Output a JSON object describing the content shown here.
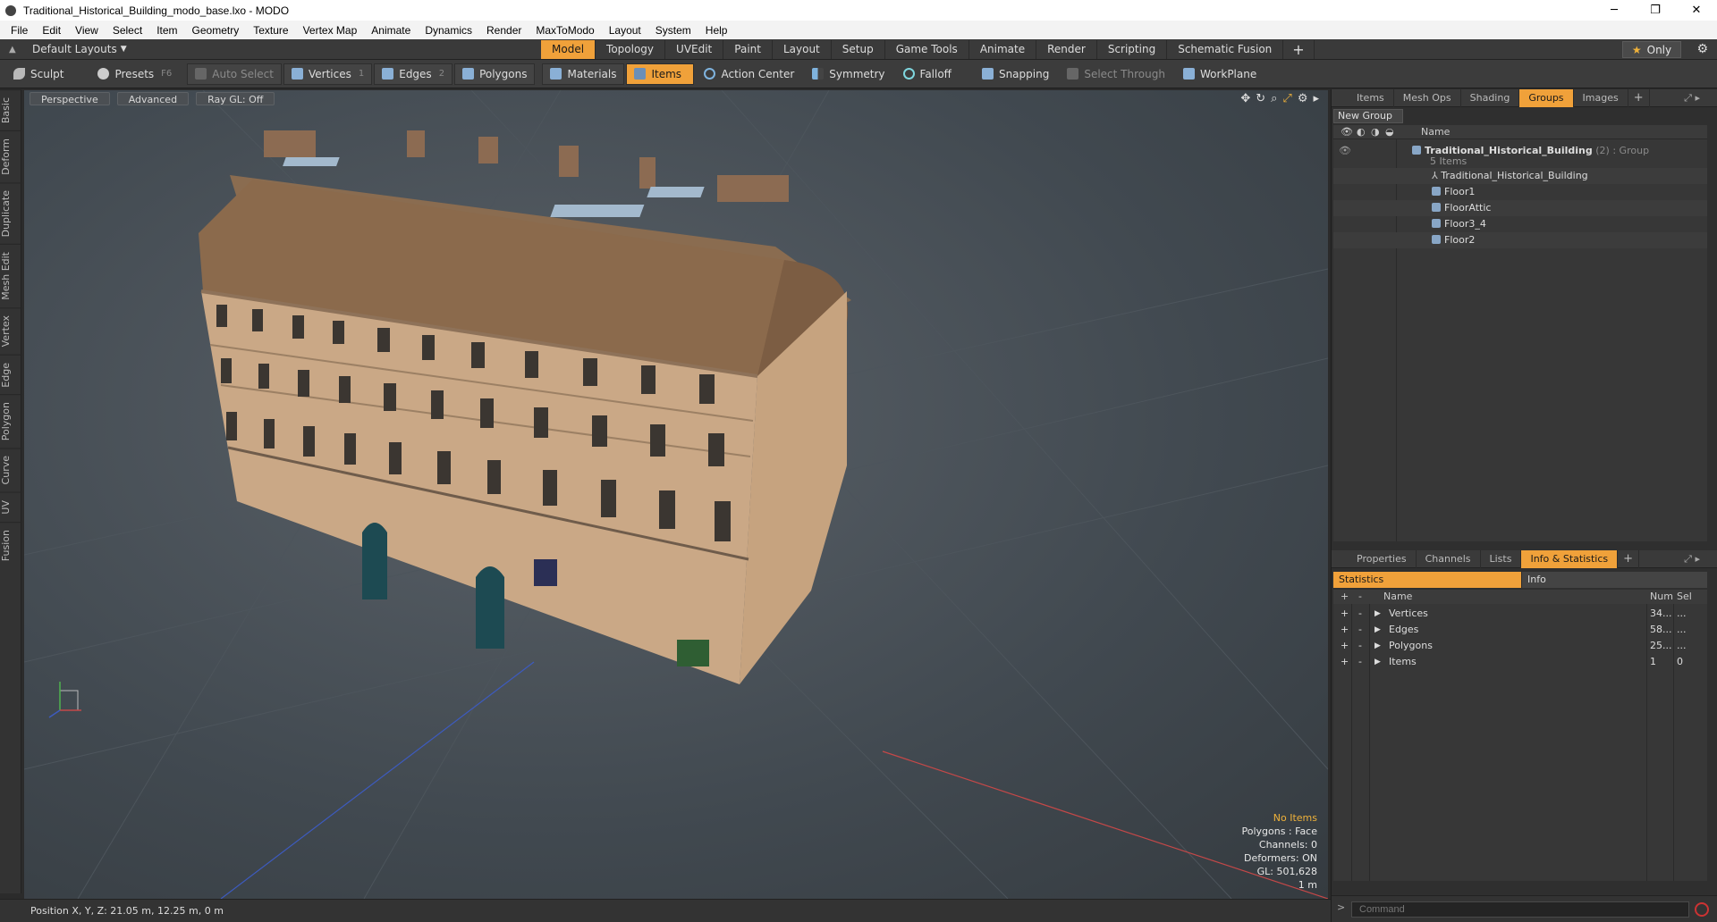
{
  "window": {
    "title": "Traditional_Historical_Building_modo_base.lxo - MODO",
    "minimize": "─",
    "maximize": "❐",
    "close": "✕"
  },
  "menu": [
    "File",
    "Edit",
    "View",
    "Select",
    "Item",
    "Geometry",
    "Texture",
    "Vertex Map",
    "Animate",
    "Dynamics",
    "Render",
    "MaxToModo",
    "Layout",
    "System",
    "Help"
  ],
  "layout": {
    "dropdown": "Default Layouts",
    "tabs": [
      "Model",
      "Topology",
      "UVEdit",
      "Paint",
      "Layout",
      "Setup",
      "Game Tools",
      "Animate",
      "Render",
      "Scripting",
      "Schematic Fusion"
    ],
    "active_tab": "Model",
    "plus": "+",
    "only": "Only"
  },
  "toolbar": {
    "sculpt": "Sculpt",
    "presets": "Presets",
    "presets_key": "F6",
    "auto_select": "Auto Select",
    "vertices": "Vertices",
    "vertices_key": "1",
    "edges": "Edges",
    "edges_key": "2",
    "polygons": "Polygons",
    "materials": "Materials",
    "items": "Items",
    "action_center": "Action Center",
    "symmetry": "Symmetry",
    "falloff": "Falloff",
    "snapping": "Snapping",
    "select_through": "Select Through",
    "workplane": "WorkPlane"
  },
  "left_tabs": [
    "Basic",
    "Deform",
    "Duplicate",
    "Mesh Edit",
    "Vertex",
    "Edge",
    "Polygon",
    "Curve",
    "UV",
    "Fusion"
  ],
  "viewport": {
    "view": "Perspective",
    "shading": "Advanced",
    "raygl": "Ray GL: Off",
    "info": {
      "selection": "No Items",
      "polygons": "Polygons : Face",
      "channels": "Channels: 0",
      "deformers": "Deformers: ON",
      "gl": "GL: 501,628",
      "scale": "1 m"
    }
  },
  "status": {
    "position": "Position X, Y, Z:  21.05 m, 12.25 m, 0 m"
  },
  "top_panel": {
    "tabs": [
      "Items",
      "Mesh Ops",
      "Shading",
      "Groups",
      "Images"
    ],
    "active_tab": "Groups",
    "new_group": "New Group",
    "name_header": "Name",
    "group": {
      "name": "Traditional_Historical_Building",
      "count": "(2)",
      "type": ": Group",
      "items_label": "5 Items",
      "children": [
        "Traditional_Historical_Building",
        "Floor1",
        "FloorAttic",
        "Floor3_4",
        "Floor2"
      ]
    }
  },
  "bottom_panel": {
    "tabs": [
      "Properties",
      "Channels",
      "Lists",
      "Info & Statistics"
    ],
    "active_tab": "Info & Statistics",
    "subtabs": [
      "Statistics",
      "Info"
    ],
    "headers": {
      "name": "Name",
      "num": "Num",
      "sel": "Sel"
    },
    "rows": [
      {
        "name": "Vertices",
        "num": "34...",
        "sel": "..."
      },
      {
        "name": "Edges",
        "num": "58...",
        "sel": "..."
      },
      {
        "name": "Polygons",
        "num": "25...",
        "sel": "..."
      },
      {
        "name": "Items",
        "num": "1",
        "sel": "0"
      }
    ]
  },
  "command": {
    "placeholder": "Command",
    "arrow": ">"
  }
}
